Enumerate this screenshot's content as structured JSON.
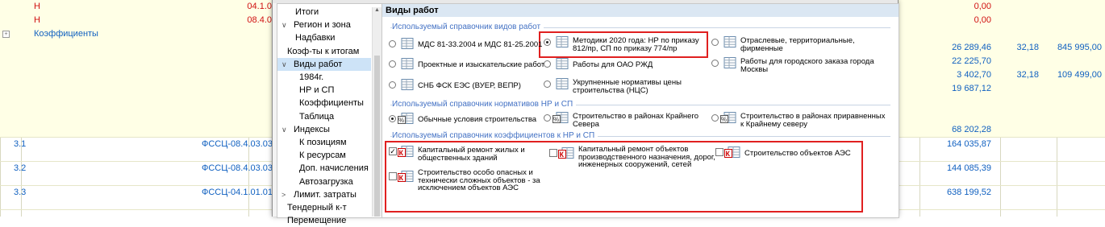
{
  "sheet": {
    "rows": [
      {
        "num": "",
        "code": "Н",
        "name": "04.1.0",
        "sum": "0,00",
        "coef": "",
        "total": ""
      },
      {
        "num": "",
        "code": "Н",
        "name": "08.4.0",
        "sum": "0,00",
        "coef": "",
        "total": ""
      },
      {
        "num": "",
        "code": "Коэффициенты",
        "name": "",
        "sum": "",
        "coef": "",
        "total": ""
      },
      {
        "num": "",
        "code": "",
        "name": "",
        "sum": "26 289,46",
        "coef": "32,18",
        "total": "845 995,00"
      },
      {
        "num": "",
        "code": "",
        "name": "",
        "sum": "22 225,70",
        "coef": "",
        "total": ""
      },
      {
        "num": "",
        "code": "",
        "name": "",
        "sum": "3 402,70",
        "coef": "32,18",
        "total": "109 499,00"
      },
      {
        "num": "",
        "code": "",
        "name": "",
        "sum": "19 687,12",
        "coef": "",
        "total": ""
      },
      {
        "num": "",
        "code": "",
        "name": "",
        "sum": "",
        "coef": "",
        "total": ""
      },
      {
        "num": "",
        "code": "",
        "name": "",
        "sum": "",
        "coef": "",
        "total": ""
      },
      {
        "num": "",
        "code": "",
        "name": "",
        "sum": "68 202,28",
        "coef": "",
        "total": ""
      },
      {
        "num": "3.1",
        "code": "",
        "name": "ФССЦ-08.4.03.03-",
        "sum": "164 035,87",
        "coef": "",
        "total": ""
      },
      {
        "num": "3.2",
        "code": "",
        "name": "ФССЦ-08.4.03.03-",
        "sum": "144 085,39",
        "coef": "",
        "total": ""
      },
      {
        "num": "3.3",
        "code": "",
        "name": "ФССЦ-04.1.01.01-",
        "sum": "638 199,52",
        "coef": "",
        "total": ""
      }
    ]
  },
  "nav": {
    "items": [
      {
        "label": "Итоги",
        "chev": ""
      },
      {
        "label": "Регион и зона",
        "chev": "∨"
      },
      {
        "label": "Надбавки",
        "chev": ""
      },
      {
        "label": "Коэф-ты к итогам",
        "chev": ""
      },
      {
        "label": "Виды работ",
        "chev": "∨"
      },
      {
        "label": "1984г.",
        "chev": ""
      },
      {
        "label": "НР и СП",
        "chev": ""
      },
      {
        "label": "Коэффициенты",
        "chev": ""
      },
      {
        "label": "Таблица",
        "chev": ""
      },
      {
        "label": "Индексы",
        "chev": "∨"
      },
      {
        "label": "К позициям",
        "chev": ""
      },
      {
        "label": "К ресурсам",
        "chev": ""
      },
      {
        "label": "Доп. начисления",
        "chev": ""
      },
      {
        "label": "Автозагрузка",
        "chev": ""
      },
      {
        "label": "Лимит. затраты",
        "chev": ">"
      },
      {
        "label": "Тендерный к-т",
        "chev": ""
      },
      {
        "label": "Перемещение",
        "chev": ""
      }
    ]
  },
  "content": {
    "header": "Виды работ",
    "section1": "Используемый справочник видов работ",
    "section2": "Используемый справочник нормативов НР и СП",
    "section3": "Используемый справочник коэффициентов к НР и СП",
    "work_types": [
      {
        "l1": "МДС 81-33.2004 и МДС 81-25.2001",
        "l2": "",
        "selected": false
      },
      {
        "l1": "Методики 2020 года: НР по приказу",
        "l2": "812/пр, СП по приказу 774/пр",
        "selected": true
      },
      {
        "l1": "Отраслевые, территориальные,",
        "l2": "фирменные",
        "selected": false
      },
      {
        "l1": "Проектные и изыскательские работы",
        "l2": "",
        "selected": false
      },
      {
        "l1": "Работы для ОАО РЖД",
        "l2": "",
        "selected": false
      },
      {
        "l1": "Работы для городского заказа города",
        "l2": "Москвы",
        "selected": false
      },
      {
        "l1": "СНБ ФСК ЕЭС (ВУЕР, ВЕПР)",
        "l2": "",
        "selected": false
      },
      {
        "l1": "Укрупненные нормативы цены",
        "l2": "строительства (НЦС)",
        "selected": false
      }
    ],
    "norms": [
      {
        "l1": "Обычные условия строительства",
        "l2": "",
        "selected": true
      },
      {
        "l1": "Строительство в районах Крайнего",
        "l2": "Севера",
        "selected": false
      },
      {
        "l1": "Строительство в районах приравненных",
        "l2": "к Крайнему северу",
        "selected": false
      }
    ],
    "coefs": [
      {
        "l1": "Капитальный ремонт жилых и",
        "l2": "общественных зданий",
        "l3": "",
        "checked": true
      },
      {
        "l1": "Капитальный ремонт объектов",
        "l2": "производственного назначения, дорог,",
        "l3": "инженерных сооружений, сетей",
        "checked": false
      },
      {
        "l1": "Строительство объектов АЭС",
        "l2": "",
        "l3": "",
        "checked": false
      },
      {
        "l1": "Строительство особо опасных и",
        "l2": "технически сложных объектов - за",
        "l3": "исключением объектов АЭС",
        "checked": false
      }
    ],
    "check_glyph": "✓",
    "icon_letter": "К",
    "percent_glyph": "%"
  },
  "colors": {
    "accent_red": "#e02020",
    "selection": "#cde3f7",
    "section_blue": "#4472c4"
  }
}
